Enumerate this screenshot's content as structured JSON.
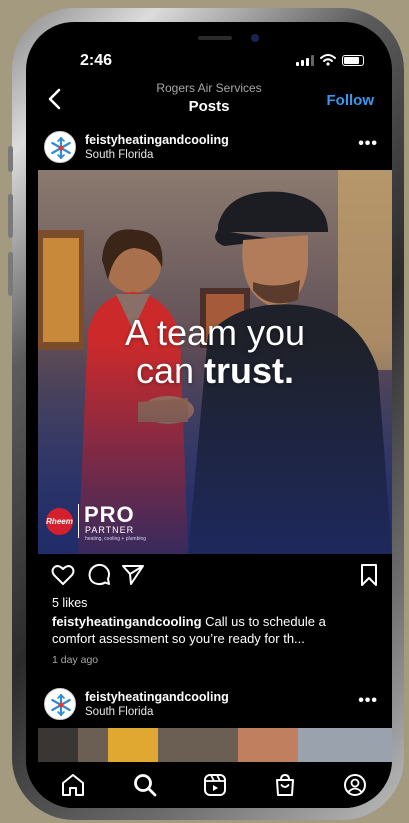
{
  "status_bar": {
    "time": "2:46"
  },
  "nav": {
    "subtitle": "Rogers Air Services",
    "title": "Posts",
    "follow_label": "Follow"
  },
  "post": {
    "account": "feistyheatingandcooling",
    "location": "South Florida",
    "image": {
      "headline_line1": "A team you",
      "headline_line2_prefix": "can ",
      "headline_line2_bold": "trust.",
      "brand_rheem": "Rheem",
      "brand_pro": "PRO",
      "brand_partner": "PARTNER",
      "brand_tagline": "heating, cooling + plumbing"
    },
    "likes": "5 likes",
    "caption_user": "feistyheatingandcooling",
    "caption_text": " Call us to schedule a comfort assessment so you’re ready for th...",
    "time_ago": "1 day ago"
  },
  "next_post": {
    "account": "feistyheatingandcooling",
    "location": "South Florida"
  },
  "icons": {
    "back": "chevron-left-icon",
    "more": "more-horizontal-icon",
    "like": "heart-icon",
    "comment": "comment-icon",
    "share": "send-icon",
    "save": "bookmark-icon",
    "home": "home-icon",
    "search": "search-icon",
    "reels": "reels-icon",
    "shop": "shop-icon",
    "profile": "profile-icon"
  },
  "colors": {
    "accent": "#3897f0",
    "background": "#000000",
    "brand_red": "#d4202c"
  }
}
